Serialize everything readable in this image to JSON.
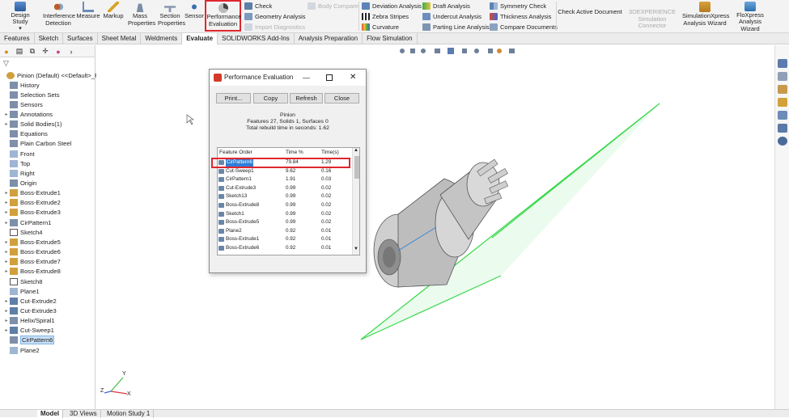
{
  "ribbon": {
    "large_buttons": [
      {
        "label": "Design Study",
        "icon": "design-study-icon"
      },
      {
        "label": "Interference Detection",
        "icon": "interference-icon"
      },
      {
        "label": "Measure",
        "icon": "measure-icon"
      },
      {
        "label": "Markup",
        "icon": "markup-icon"
      },
      {
        "label": "Mass Properties",
        "icon": "mass-properties-icon"
      },
      {
        "label": "Section Properties",
        "icon": "section-properties-icon"
      },
      {
        "label": "Sensor",
        "icon": "sensor-icon"
      },
      {
        "label": "Performance Evaluation",
        "icon": "performance-evaluation-icon"
      }
    ],
    "small_col1": [
      {
        "label": "Check",
        "icon": "check-icon"
      },
      {
        "label": "Geometry Analysis",
        "icon": "geometry-analysis-icon"
      },
      {
        "label": "Import Diagnostics",
        "icon": "import-diagnostics-icon"
      }
    ],
    "body_compare": "Body Compare",
    "small_col2": [
      {
        "label": "Deviation Analysis",
        "icon": "deviation-analysis-icon"
      },
      {
        "label": "Zebra Stripes",
        "icon": "zebra-stripes-icon"
      },
      {
        "label": "Curvature",
        "icon": "curvature-icon"
      }
    ],
    "small_col3": [
      {
        "label": "Draft Analysis",
        "icon": "draft-analysis-icon"
      },
      {
        "label": "Undercut Analysis",
        "icon": "undercut-analysis-icon"
      },
      {
        "label": "Parting Line Analysis",
        "icon": "parting-line-icon"
      }
    ],
    "small_col4": [
      {
        "label": "Symmetry Check",
        "icon": "symmetry-check-icon"
      },
      {
        "label": "Thickness Analysis",
        "icon": "thickness-analysis-icon"
      },
      {
        "label": "Compare Documents",
        "icon": "compare-documents-icon"
      }
    ],
    "right_buttons": [
      {
        "label": "Check Active Document"
      },
      {
        "label": "3DEXPERIENCE Simulation Connector"
      },
      {
        "label": "SimulationXpress Analysis Wizard"
      },
      {
        "label": "FloXpress Analysis Wizard"
      }
    ]
  },
  "tabs": [
    "Features",
    "Sketch",
    "Surfaces",
    "Sheet Metal",
    "Weldments",
    "Evaluate",
    "SOLIDWORKS Add-Ins",
    "Analysis Preparation",
    "Flow Simulation"
  ],
  "active_tab": "Evaluate",
  "tree": {
    "root": "Pinion (Default) <<Default>_P",
    "items": [
      "History",
      "Selection Sets",
      "Sensors",
      "Annotations",
      "Solid Bodies(1)",
      "Equations",
      "Plain Carbon Steel",
      "Front",
      "Top",
      "Right",
      "Origin",
      "Boss-Extrude1",
      "Boss-Extrude2",
      "Boss-Extrude3",
      "CirPattern1",
      "Sketch4",
      "Boss-Extrude5",
      "Boss-Extrude6",
      "Boss-Extrude7",
      "Boss-Extrude8",
      "Sketch8",
      "Plane1",
      "Cut-Extrude2",
      "Cut-Extrude3",
      "Helix/Spiral1",
      "Cut-Sweep1",
      "CirPattern6",
      "Plane2"
    ],
    "selected": "CirPattern6"
  },
  "dialog": {
    "title": "Performance Evaluation",
    "buttons": [
      "Print...",
      "Copy",
      "Refresh",
      "Close"
    ],
    "part_name": "Pinion",
    "summary": "Features 27, Solids 1, Surfaces 0",
    "rebuild": "Total rebuild time in seconds: 1.62",
    "headers": [
      "Feature Order",
      "Time %",
      "Time(s)"
    ],
    "rows": [
      [
        "CirPattern6",
        "79.84",
        "1.29"
      ],
      [
        "Cut-Sweep1",
        "9.62",
        "0.16"
      ],
      [
        "CirPattern1",
        "1.91",
        "0.03"
      ],
      [
        "Cut-Extrude3",
        "0.99",
        "0.02"
      ],
      [
        "Sketch13",
        "0.99",
        "0.02"
      ],
      [
        "Boss-Extrude8",
        "0.99",
        "0.02"
      ],
      [
        "Sketch1",
        "0.99",
        "0.02"
      ],
      [
        "Boss-Extrude5",
        "0.99",
        "0.02"
      ],
      [
        "Plane2",
        "0.92",
        "0.01"
      ],
      [
        "Boss-Extrude1",
        "0.92",
        "0.01"
      ],
      [
        "Boss-Extrude6",
        "0.92",
        "0.01"
      ]
    ]
  },
  "bottom_tabs": [
    "Model",
    "3D Views",
    "Motion Study 1"
  ],
  "triad": {
    "x": "X",
    "y": "Y",
    "z": "Z"
  },
  "colors": {
    "highlight": "#e0262e",
    "plane": "#39d84a",
    "selection": "#2f7fd6"
  }
}
